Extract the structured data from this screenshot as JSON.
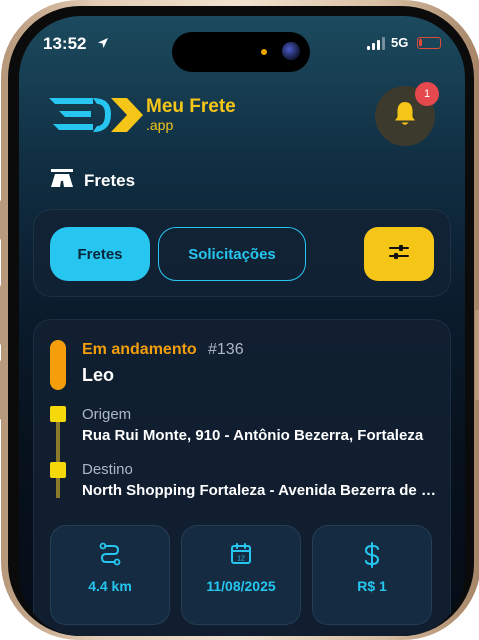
{
  "status_bar": {
    "time": "13:52",
    "network": "5G"
  },
  "header": {
    "brand_name": "Meu Frete",
    "brand_suffix": ".app",
    "notification_count": "1"
  },
  "section": {
    "title": "Fretes"
  },
  "tabs": [
    {
      "label": "Fretes",
      "active": true
    },
    {
      "label": "Solicitações",
      "active": false
    }
  ],
  "frete": {
    "status": "Em andamento",
    "id": "#136",
    "client": "Leo",
    "origin_label": "Origem",
    "origin_address": "Rua Rui Monte, 910 - Antônio Bezerra, Fortaleza",
    "destination_label": "Destino",
    "destination_address": "North Shopping Fortaleza - Avenida Bezerra de Menezes",
    "distance": "4.4 km",
    "date": "11/08/2025",
    "price": "R$ 1"
  },
  "icons": [
    "location-arrow-icon",
    "signal-icon",
    "battery-icon",
    "truck-logo-icon",
    "bell-icon",
    "road-icon",
    "sliders-icon",
    "route-icon",
    "calendar-icon",
    "dollar-icon"
  ],
  "colors": {
    "accent_cyan": "#26c6f0",
    "accent_yellow": "#f5c518",
    "status_orange": "#f59e0b",
    "badge_red": "#e5484d",
    "background": "#07111d"
  }
}
